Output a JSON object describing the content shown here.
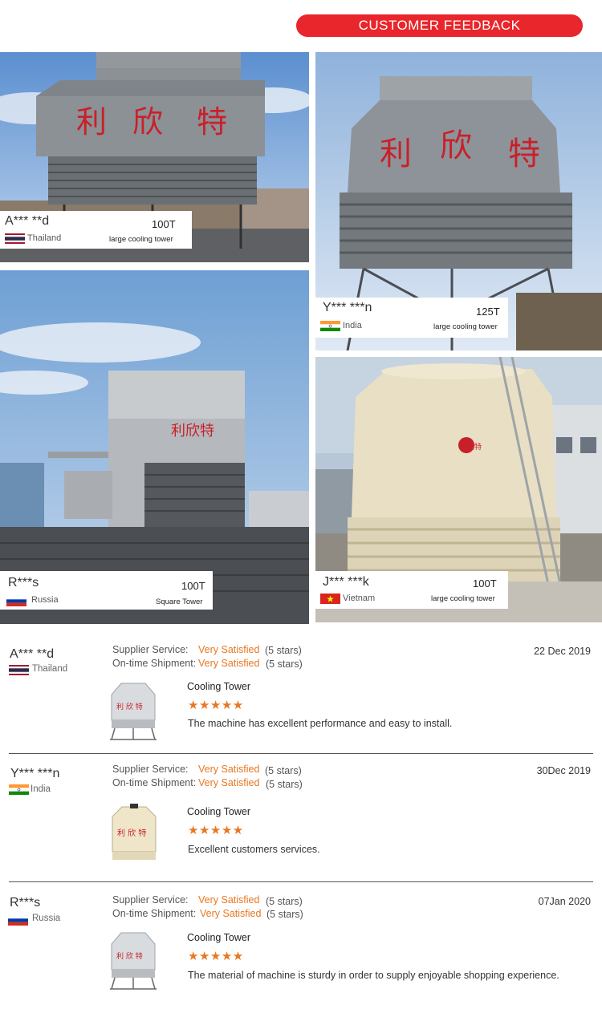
{
  "header": {
    "title": "CUSTOMER FEEDBACK"
  },
  "photos": [
    {
      "name": "A*** **d",
      "capacity": "100T",
      "type": "large cooling tower",
      "country": "Thailand",
      "flag": "thailand-flag"
    },
    {
      "name": "Y*** ***n",
      "capacity": "125T",
      "type": "large cooling tower",
      "country": "India",
      "flag": "india-flag"
    },
    {
      "name": "R***s",
      "capacity": "100T",
      "type": "Square Tower",
      "country": "Russia",
      "flag": "russia-flag"
    },
    {
      "name": "J*** ***k",
      "capacity": "100T",
      "type": "large cooling tower",
      "country": "Vietnam",
      "flag": "vietnam-flag"
    }
  ],
  "tower_lettering": [
    "利",
    "欣",
    "特"
  ],
  "tower_lettering_combined": "利欣特",
  "reviews": [
    {
      "name": "A*** **d",
      "country": "Thailand",
      "date": "22 Dec 2019",
      "service_label": "Supplier Service:",
      "service_value": "Very Satisfied",
      "service_stars": "(5 stars)",
      "shipment_label": "On-time Shipment:",
      "shipment_value": "Very Satisfied",
      "shipment_stars": "(5 stars)",
      "product": "Cooling Tower",
      "stars": "★★★★★",
      "comment": "The machine has  excellent performance and easy to install."
    },
    {
      "name": "Y*** ***n",
      "country": "India",
      "date": "30Dec 2019",
      "service_label": "Supplier Service:",
      "service_value": "Very Satisfied",
      "service_stars": "(5 stars)",
      "shipment_label": "On-time Shipment:",
      "shipment_value": "Very Satisfied",
      "shipment_stars": "(5 stars)",
      "product": "Cooling Tower",
      "stars": "★★★★★",
      "comment": "Excellent customers services."
    },
    {
      "name": "R***s",
      "country": "Russia",
      "date": "07Jan 2020",
      "service_label": "Supplier Service:",
      "service_value": "Very Satisfied",
      "service_stars": "(5 stars)",
      "shipment_label": "On-time Shipment:",
      "shipment_value": "Very Satisfied",
      "shipment_stars": "(5 stars)",
      "product": "Cooling Tower",
      "stars": "★★★★★",
      "comment": "The material of machine is sturdy in order to supply enjoyable shopping experience."
    }
  ],
  "colors": {
    "header": "#e8262b",
    "accent": "#e87722",
    "tower_grey": "#8a8f95",
    "tower_beige": "#e8dfc4",
    "lettering_red": "#c8202a"
  }
}
